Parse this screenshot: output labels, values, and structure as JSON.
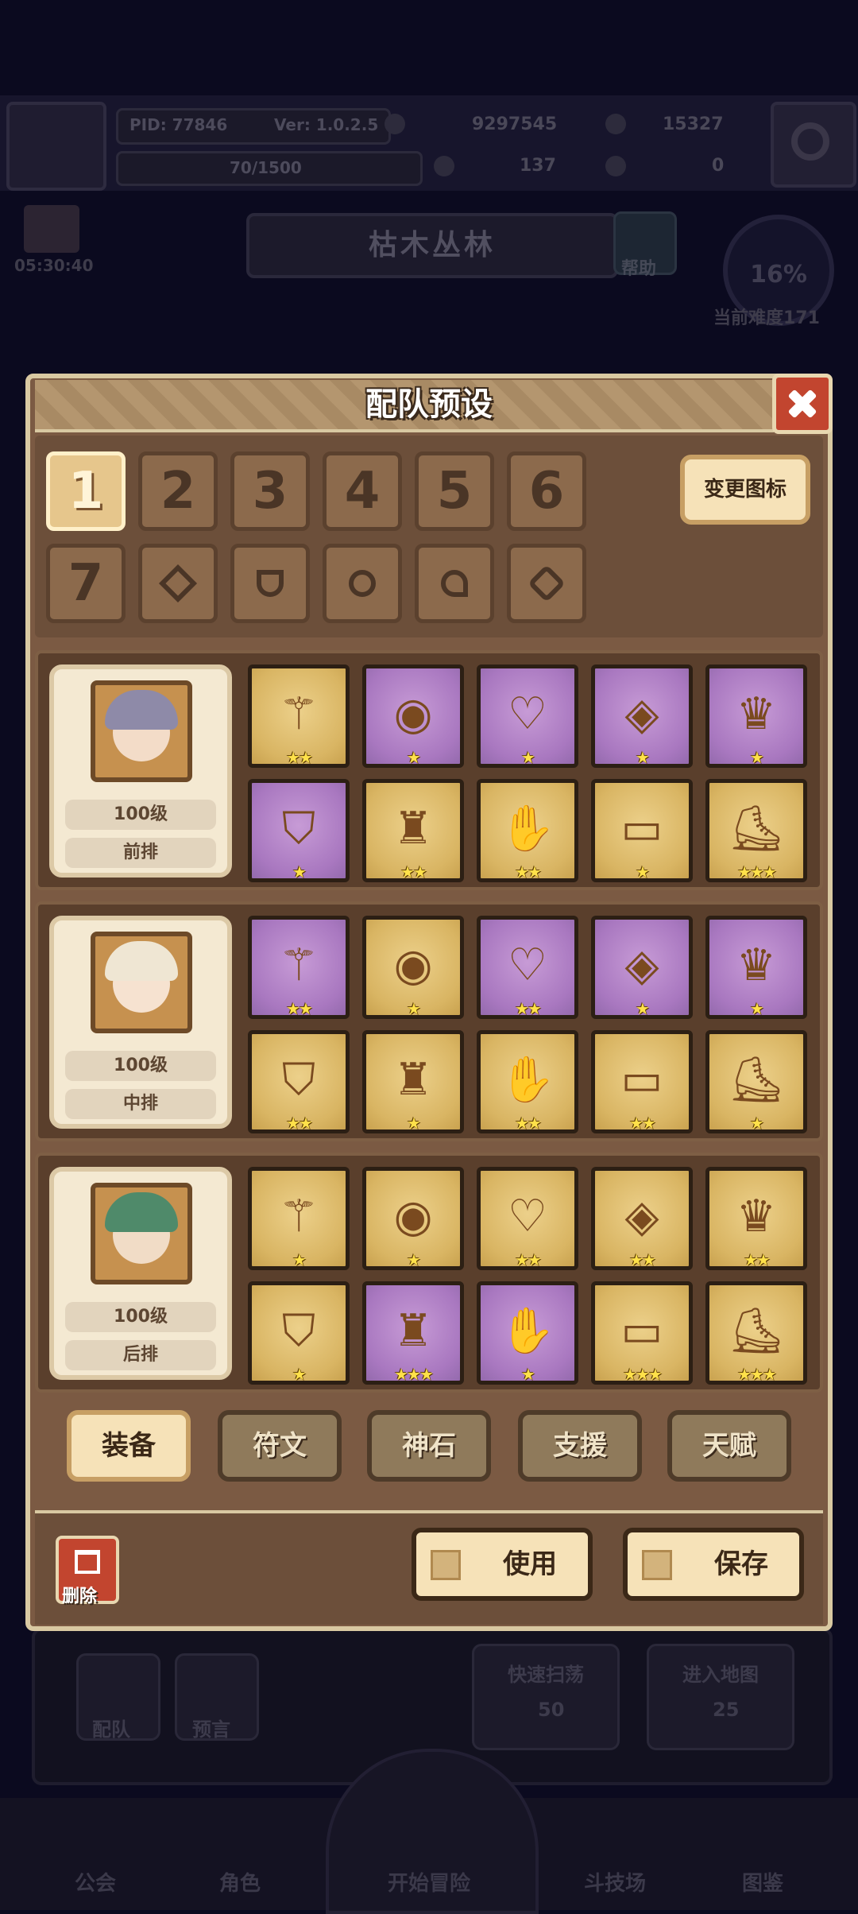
{
  "background": {
    "pid": "PID: 77846",
    "version": "Ver: 1.0.2.5",
    "gold": "9297545",
    "gems": "15327",
    "stamina": "70/1500",
    "clovers": "137",
    "keys": "0",
    "gift_timer": "05:30:40",
    "zone_name": "枯木丛林",
    "help": "帮助",
    "progress": "16%",
    "difficulty": "当前难度171",
    "quick_sweep": "快速扫荡",
    "quick_sweep_cost": "50",
    "enter_map": "进入地图",
    "enter_map_cost": "25",
    "team_btn": "配队",
    "forecast_btn": "预言",
    "nav": [
      "公会",
      "角色",
      "开始冒险",
      "斗技场",
      "图鉴"
    ]
  },
  "modal": {
    "title": "配队预设",
    "change_icon": "变更图标",
    "presets": [
      "1",
      "2",
      "3",
      "4",
      "5",
      "6",
      "7"
    ],
    "preset_icons": [
      "sword-icon",
      "shield-icon",
      "bow-icon",
      "staff-icon",
      "gear-icon"
    ],
    "tabs": [
      "装备",
      "符文",
      "神石",
      "支援",
      "天赋"
    ],
    "delete": "删除",
    "use": "使用",
    "save": "保存"
  },
  "teams": [
    {
      "level": "100级",
      "position": "前排",
      "hair_color": "#8e8aa8",
      "items": [
        {
          "icon": "staff-icon",
          "rarity": "gold",
          "stars": 2
        },
        {
          "icon": "orb-icon",
          "rarity": "purple",
          "stars": 1
        },
        {
          "icon": "necklace-icon",
          "rarity": "purple",
          "stars": 1
        },
        {
          "icon": "ring-icon",
          "rarity": "purple",
          "stars": 1
        },
        {
          "icon": "crown-ring-icon",
          "rarity": "purple",
          "stars": 1
        },
        {
          "icon": "helmet-icon",
          "rarity": "purple",
          "stars": 1
        },
        {
          "icon": "armor-icon",
          "rarity": "gold",
          "stars": 2
        },
        {
          "icon": "glove-icon",
          "rarity": "gold",
          "stars": 2
        },
        {
          "icon": "belt-icon",
          "rarity": "gold",
          "stars": 1
        },
        {
          "icon": "boots-icon",
          "rarity": "gold",
          "stars": 3
        }
      ]
    },
    {
      "level": "100级",
      "position": "中排",
      "hair_color": "#efe6d3",
      "items": [
        {
          "icon": "staff-icon",
          "rarity": "purple",
          "stars": 2
        },
        {
          "icon": "orb-icon",
          "rarity": "gold",
          "stars": 1
        },
        {
          "icon": "necklace-icon",
          "rarity": "purple",
          "stars": 2
        },
        {
          "icon": "ring-icon",
          "rarity": "purple",
          "stars": 1
        },
        {
          "icon": "crown-ring-icon",
          "rarity": "purple",
          "stars": 1
        },
        {
          "icon": "helmet-icon",
          "rarity": "gold",
          "stars": 2
        },
        {
          "icon": "armor-icon",
          "rarity": "gold",
          "stars": 1
        },
        {
          "icon": "glove-icon",
          "rarity": "gold",
          "stars": 2
        },
        {
          "icon": "belt-icon",
          "rarity": "gold",
          "stars": 2
        },
        {
          "icon": "boots-icon",
          "rarity": "gold",
          "stars": 1
        }
      ]
    },
    {
      "level": "100级",
      "position": "后排",
      "hair_color": "#4f8a6a",
      "items": [
        {
          "icon": "staff-icon",
          "rarity": "gold",
          "stars": 1
        },
        {
          "icon": "orb-icon",
          "rarity": "gold",
          "stars": 1
        },
        {
          "icon": "necklace-icon",
          "rarity": "gold",
          "stars": 2
        },
        {
          "icon": "ring-icon",
          "rarity": "gold",
          "stars": 2
        },
        {
          "icon": "crown-ring-icon",
          "rarity": "gold",
          "stars": 2
        },
        {
          "icon": "helmet-icon",
          "rarity": "gold",
          "stars": 1
        },
        {
          "icon": "armor-icon",
          "rarity": "purple",
          "stars": 3
        },
        {
          "icon": "glove-icon",
          "rarity": "purple",
          "stars": 1
        },
        {
          "icon": "belt-icon",
          "rarity": "gold",
          "stars": 3
        },
        {
          "icon": "boots-icon",
          "rarity": "gold",
          "stars": 3
        }
      ]
    }
  ]
}
